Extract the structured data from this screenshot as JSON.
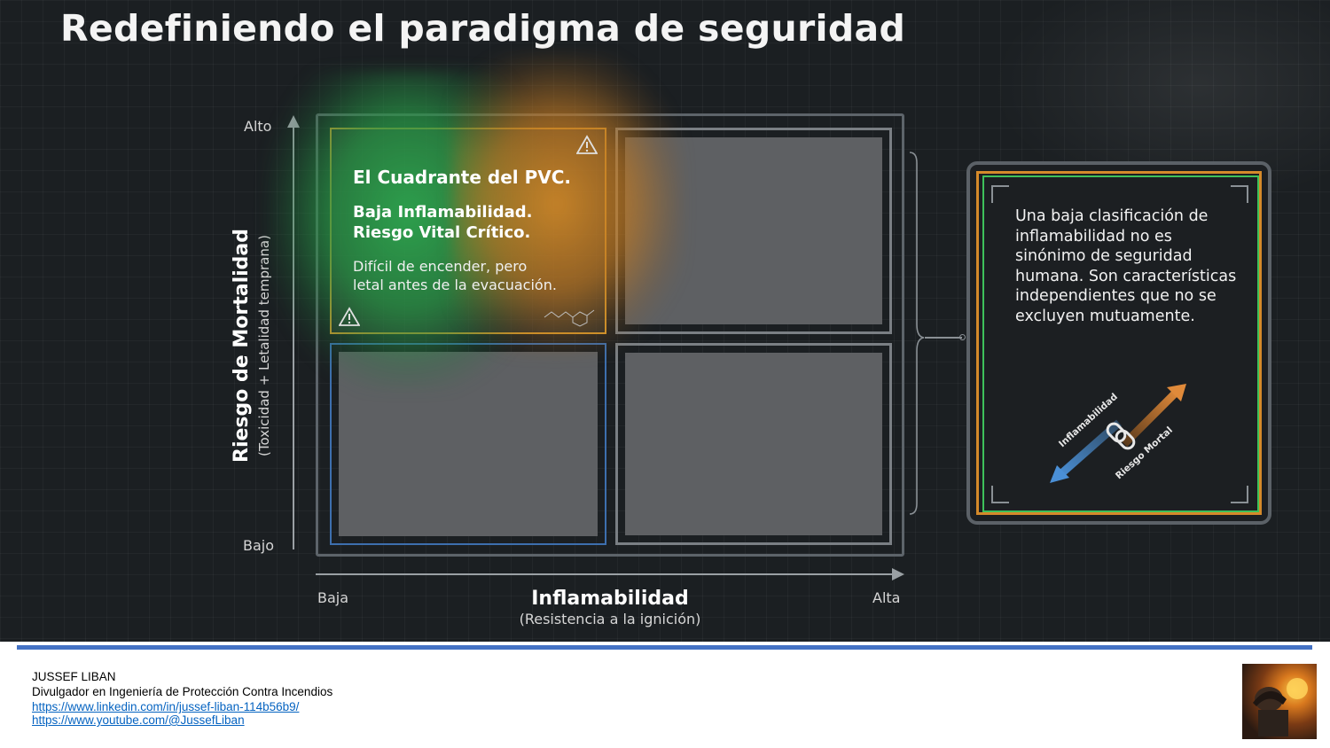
{
  "slide": {
    "title": "Redefiniendo el paradigma de seguridad",
    "y_axis": {
      "title": "Riesgo de Mortalidad",
      "subtitle": "(Toxicidad + Letalidad temprana)",
      "high": "Alto",
      "low": "Bajo"
    },
    "x_axis": {
      "title": "Inflamabilidad",
      "subtitle": "(Resistencia a la ignición)",
      "low": "Baja",
      "high": "Alta"
    },
    "pvc_quadrant": {
      "title": "El Cuadrante del PVC.",
      "bold_line_1": "Baja Inflamabilidad.",
      "bold_line_2": "Riesgo Vital Crítico.",
      "desc_line_1": "Difícil de encender, pero",
      "desc_line_2": "letal antes de la evacuación."
    },
    "panel": {
      "text": "Una baja clasificación de inflamabilidad no es sinónimo de seguridad humana. Son características independientes que no se excluyen mutuamente.",
      "arrow_label_left": "Inflamabilidad",
      "arrow_label_right": "Riesgo Mortal"
    },
    "colors": {
      "pvc_border": "#d79a2d",
      "low_quadrant_border": "#3d6fae",
      "panel_orange": "#d58a2a",
      "panel_green": "#3ec15a",
      "accent_rule": "#4472c4"
    }
  },
  "footer": {
    "name": "JUSSEF LIBAN",
    "role": "Divulgador en Ingeniería de Protección Contra Incendios",
    "linkedin": "https://www.linkedin.com/in/jussef-liban-114b56b9/",
    "youtube": "https://www.youtube.com/@JussefLiban"
  }
}
